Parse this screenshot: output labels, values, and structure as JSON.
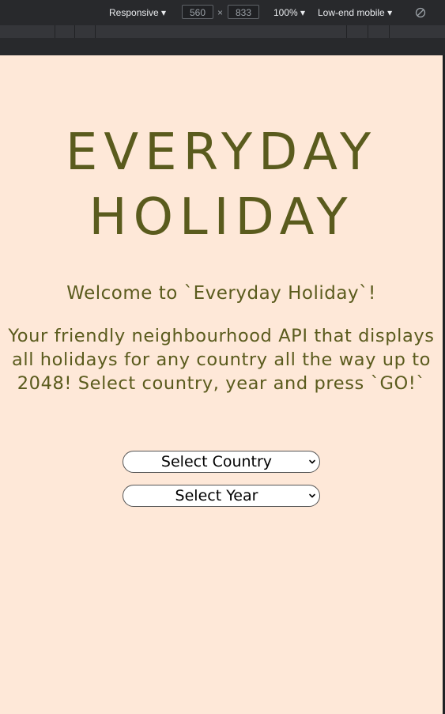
{
  "devtools": {
    "device": "Responsive",
    "width": "560",
    "times": "×",
    "height": "833",
    "zoom": "100%",
    "throttle": "Low-end mobile"
  },
  "page": {
    "title_line1": "EVERYDAY",
    "title_line2": "HOLIDAY",
    "welcome": "Welcome to `Everyday Holiday`!",
    "intro": "Your friendly neighbourhood API that displays all holidays for any country all the way up to 2048! Select country, year and press `GO!`",
    "country_select": "Select Country",
    "year_select": "Select Year"
  },
  "colors": {
    "background": "#fee8d8",
    "text": "#5a5b1d"
  }
}
